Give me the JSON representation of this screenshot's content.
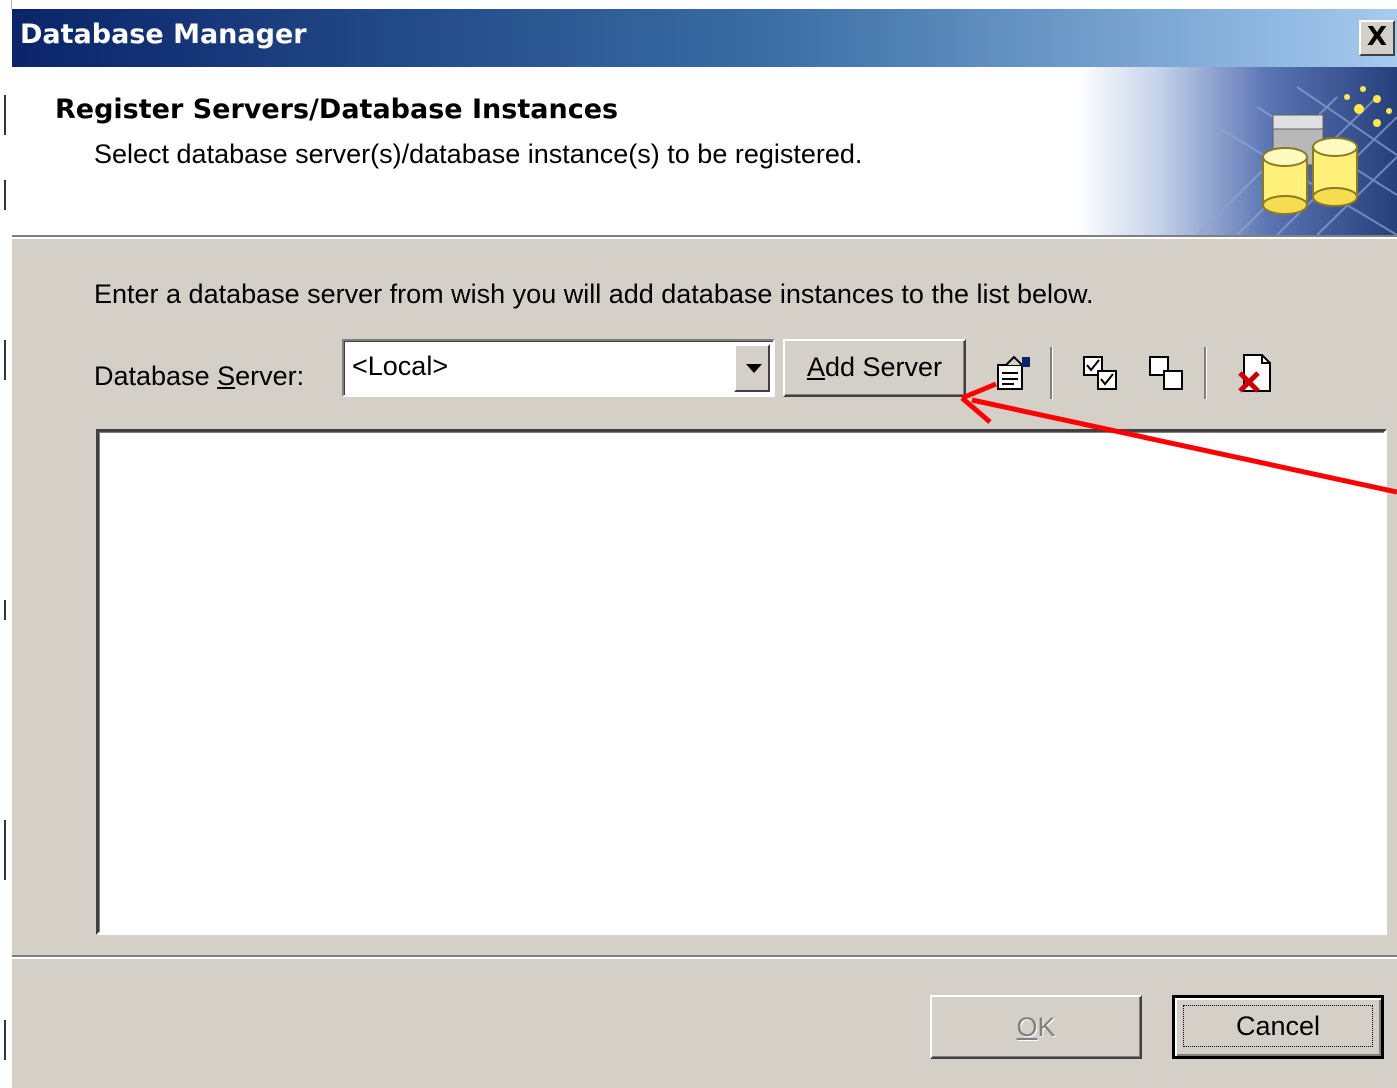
{
  "window": {
    "title": "Database Manager",
    "close_glyph": "X"
  },
  "header": {
    "title": "Register Servers/Database Instances",
    "subtitle": "Select database server(s)/database instance(s) to be registered."
  },
  "instructions": "Enter a database server from wish you will add database instances to the list below.",
  "server": {
    "label_pre": "Database ",
    "label_accel": "S",
    "label_post": "erver:",
    "value": "<Local>"
  },
  "add_server": {
    "accel": "A",
    "rest": "dd Server"
  },
  "toolbar_icons": [
    "properties-icon",
    "check-all-icon",
    "uncheck-all-icon",
    "delete-icon"
  ],
  "buttons": {
    "ok_accel": "O",
    "ok_rest": "K",
    "ok_enabled": false,
    "cancel": "Cancel"
  },
  "annotation": {
    "arrow_color": "#ff0000"
  }
}
